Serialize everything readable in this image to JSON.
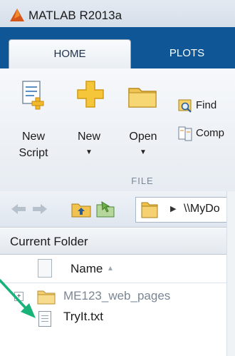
{
  "window": {
    "title": "MATLAB R2013a"
  },
  "tabs": [
    {
      "label": "HOME",
      "active": true
    },
    {
      "label": "PLOTS",
      "active": false
    }
  ],
  "toolstrip": {
    "new_script": {
      "line1": "New",
      "line2": "Script"
    },
    "new": {
      "label": "New"
    },
    "open": {
      "label": "Open"
    },
    "find_files": {
      "label": "Find"
    },
    "compare": {
      "label": "Comp"
    },
    "section": "FILE"
  },
  "address_bar": {
    "path": "\\\\MyDo"
  },
  "current_folder": {
    "title": "Current Folder",
    "column_name": "Name",
    "items": [
      {
        "name": "ME123_web_pages",
        "type": "folder"
      },
      {
        "name": "TryIt.txt",
        "type": "file"
      }
    ]
  },
  "colors": {
    "tab_strip": "#0f5696",
    "annotation_arrow": "#19b37a"
  }
}
